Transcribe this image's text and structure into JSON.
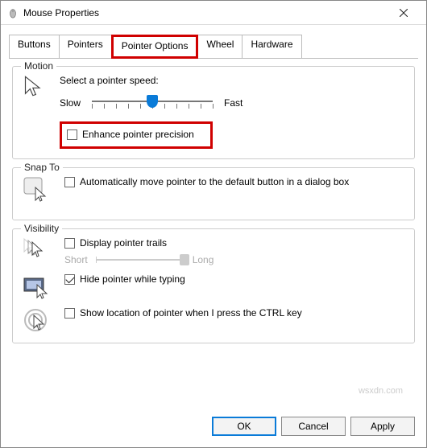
{
  "window": {
    "title": "Mouse Properties"
  },
  "tabs": {
    "buttons": "Buttons",
    "pointers": "Pointers",
    "pointer_options": "Pointer Options",
    "wheel": "Wheel",
    "hardware": "Hardware"
  },
  "motion": {
    "group_label": "Motion",
    "select_label": "Select a pointer speed:",
    "slow": "Slow",
    "fast": "Fast",
    "enhance_label": "Enhance pointer precision",
    "slider_value": 6,
    "slider_max": 11
  },
  "snap_to": {
    "group_label": "Snap To",
    "auto_label": "Automatically move pointer to the default button in a dialog box"
  },
  "visibility": {
    "group_label": "Visibility",
    "trails_label": "Display pointer trails",
    "short": "Short",
    "long": "Long",
    "hide_label": "Hide pointer while typing",
    "ctrl_label": "Show location of pointer when I press the CTRL key"
  },
  "buttons": {
    "ok": "OK",
    "cancel": "Cancel",
    "apply": "Apply"
  },
  "watermark": "wsxdn.com"
}
